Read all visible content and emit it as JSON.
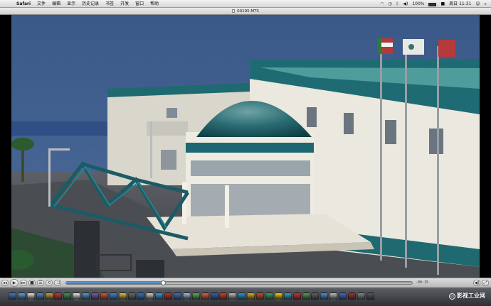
{
  "menubar": {
    "app_name": "Safari",
    "items": [
      "文件",
      "编辑",
      "显示",
      "历史记录",
      "书签",
      "开发",
      "窗口",
      "帮助"
    ],
    "battery": "100%",
    "datetime": "周日 11:31"
  },
  "window": {
    "title": "00195.MTS"
  },
  "player": {
    "time_remaining": "-00:15",
    "progress": 0.28
  },
  "watermark": {
    "text": "影视工业网"
  },
  "colors": {
    "accent": "#3a6fb4",
    "sky": "#3e5b86",
    "roof": "#1e6b73",
    "building": "#e9e6dd"
  }
}
